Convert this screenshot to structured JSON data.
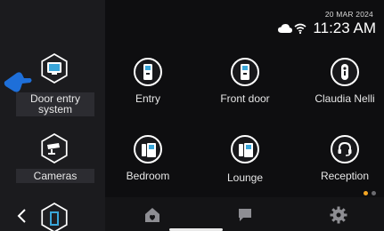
{
  "status": {
    "date": "20 MAR 2024",
    "time": "11:23 AM",
    "icons": [
      "cloud-icon",
      "wifi-icon"
    ]
  },
  "sidebar": {
    "items": [
      {
        "label_line1": "Door entry",
        "label_line2": "system",
        "icon": "monitor-icon",
        "selected": true
      },
      {
        "label": "Cameras",
        "icon": "camera-icon"
      }
    ],
    "back_icon": "chevron-left-icon",
    "door_icon": "door-icon"
  },
  "tiles": [
    {
      "label": "Entry",
      "icon": "door-station-icon"
    },
    {
      "label": "Front door",
      "icon": "door-station-icon"
    },
    {
      "label": "Claudia Nelli",
      "icon": "door-lock-icon"
    },
    {
      "label": "Bedroom",
      "icon": "intercom-handset-icon"
    },
    {
      "label": "Lounge",
      "icon": "intercom-handset-icon"
    },
    {
      "label": "Reception",
      "icon": "headset-icon"
    }
  ],
  "bottom_nav": [
    {
      "icon": "home-icon"
    },
    {
      "icon": "chat-icon"
    },
    {
      "icon": "settings-gear-icon"
    }
  ],
  "pagination": {
    "pages": 2,
    "current": 1
  },
  "colors": {
    "accent": "#f5a623",
    "pointer": "#1e6fd9"
  }
}
